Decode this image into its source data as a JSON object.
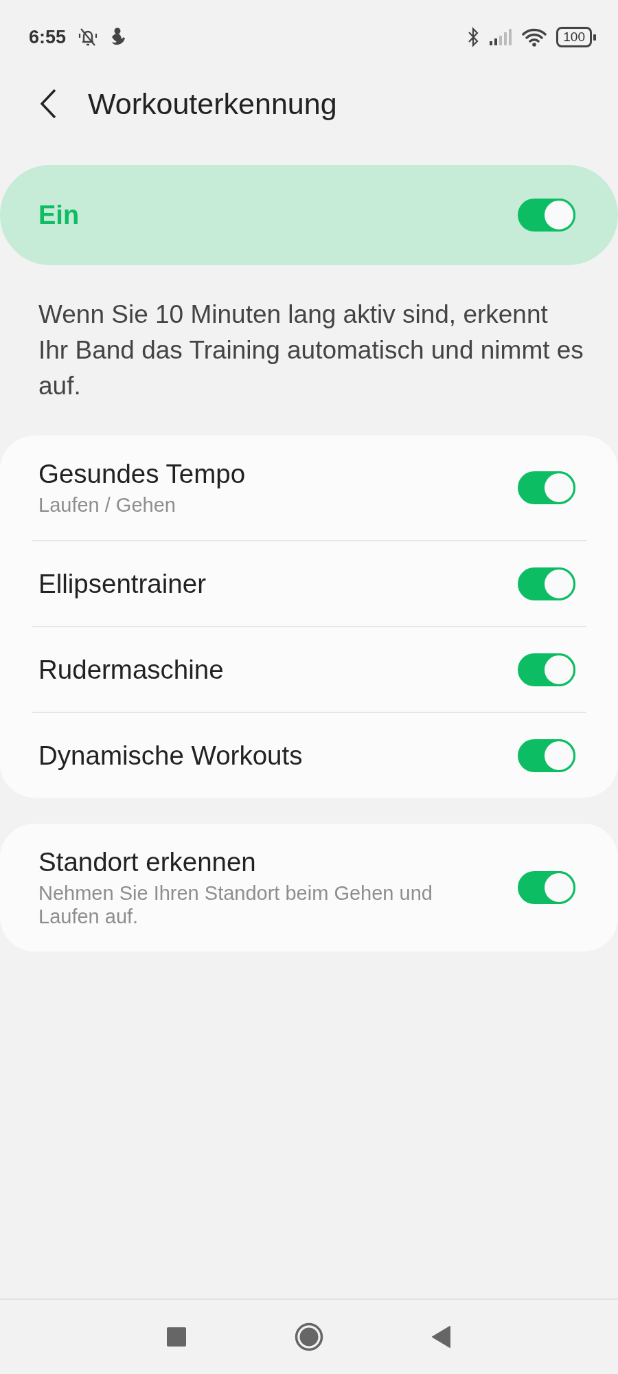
{
  "status_bar": {
    "time": "6:55",
    "battery": "100"
  },
  "header": {
    "title": "Workouterkennung"
  },
  "master": {
    "label": "Ein",
    "on": true
  },
  "description": "Wenn Sie 10 Minuten lang aktiv sind, erkennt Ihr Band das Training automatisch und nimmt es auf.",
  "groups": [
    {
      "items": [
        {
          "title": "Gesundes Tempo",
          "subtitle": "Laufen / Gehen",
          "on": true
        },
        {
          "title": "Ellipsentrainer",
          "on": true
        },
        {
          "title": "Rudermaschine",
          "on": true
        },
        {
          "title": "Dynamische Workouts",
          "on": true
        }
      ]
    },
    {
      "items": [
        {
          "title": "Standort erkennen",
          "subtitle": "Nehmen Sie Ihren Standort beim Gehen und Laufen auf.",
          "on": true
        }
      ]
    }
  ]
}
